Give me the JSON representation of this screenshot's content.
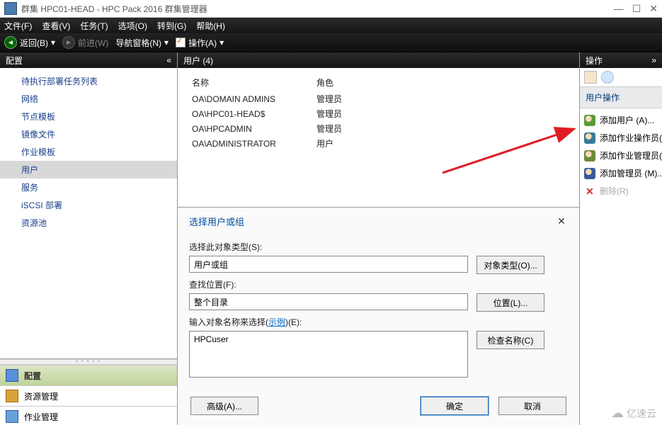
{
  "window": {
    "title": "群集 HPC01-HEAD - HPC Pack 2016 群集管理器",
    "minimize": "—",
    "maximize": "☐",
    "close": "✕"
  },
  "menu": {
    "file": "文件(F)",
    "view": "查看(V)",
    "tasks": "任务(T)",
    "options": "选项(O)",
    "goto": "转到(G)",
    "help": "帮助(H)"
  },
  "toolbar": {
    "back": "返回(B)",
    "forward": "前进(W)",
    "nav_pane": "导航窗格(N)",
    "actions": "操作(A)"
  },
  "left": {
    "header": "配置",
    "items": [
      "待执行部署任务列表",
      "网络",
      "节点模板",
      "镜像文件",
      "作业模板",
      "用户",
      "服务",
      "iSCSI 部署",
      "资源池"
    ],
    "selected_index": 5,
    "bottom": {
      "config": "配置",
      "resource": "资源管理",
      "job": "作业管理"
    }
  },
  "middle": {
    "header": "用户 (4)",
    "columns": {
      "name": "名称",
      "role": "角色"
    },
    "rows": [
      {
        "name": "OA\\DOMAIN ADMINS",
        "role": "管理员"
      },
      {
        "name": "OA\\HPC01-HEAD$",
        "role": "管理员"
      },
      {
        "name": "OA\\HPCADMIN",
        "role": "管理员"
      },
      {
        "name": "OA\\ADMINISTRATOR",
        "role": "用户"
      }
    ]
  },
  "dialog": {
    "title": "选择用户或组",
    "object_type_label": "选择此对象类型(S):",
    "object_type_value": "用户或组",
    "object_type_btn": "对象类型(O)...",
    "location_label": "查找位置(F):",
    "location_value": "整个目录",
    "location_btn": "位置(L)...",
    "names_label_prefix": "输入对象名称来选择(",
    "names_label_link": "示例",
    "names_label_suffix": ")(E):",
    "names_value": "HPCuser",
    "check_names_btn": "检查名称(C)",
    "advanced_btn": "高级(A)...",
    "ok_btn": "确定",
    "cancel_btn": "取消"
  },
  "right": {
    "header": "操作",
    "section": "用户操作",
    "actions": {
      "add_user": "添加用户 (A)...",
      "add_op": "添加作业操作员(O",
      "add_jobadmin": "添加作业管理员(J)",
      "add_admin": "添加管理员 (M)...",
      "remove": "删除(R)"
    }
  },
  "watermark": "亿速云"
}
